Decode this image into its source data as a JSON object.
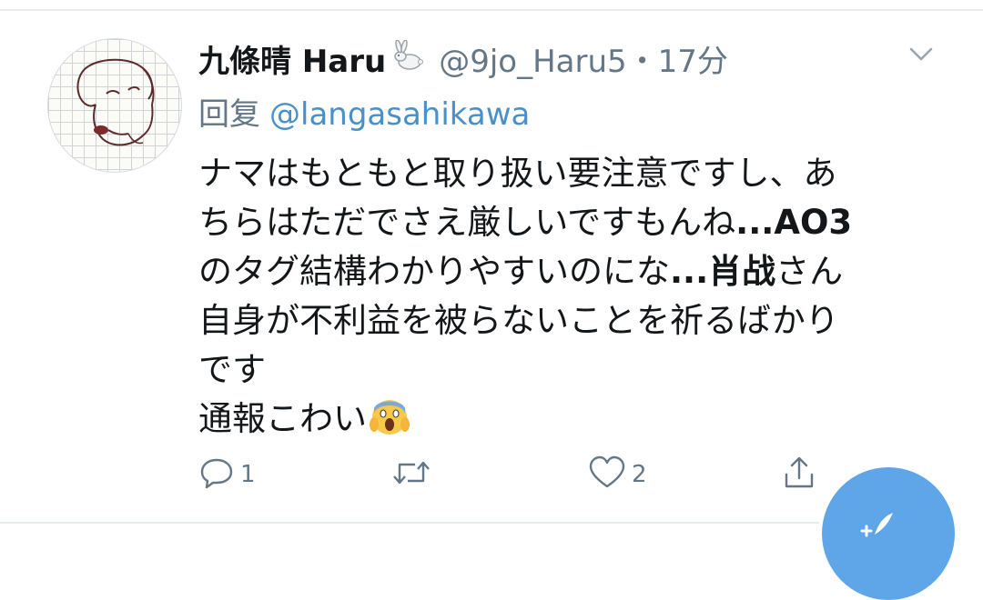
{
  "tweet": {
    "author": {
      "display_name": "九條晴 Haru",
      "name_emoji": "rabbit-emoji",
      "handle": "@9jo_Haru5",
      "separator": "・",
      "time": "17分",
      "avatar": "hand-drawn-dog-avatar"
    },
    "reply": {
      "prefix": "回复",
      "to_handle": "@langasahikawa"
    },
    "body": {
      "line1": "ナマはもともと取り扱い要注意ですし、あ",
      "line2_text": "ちらはただでさえ厳しいですもんね",
      "line2_bold": "...AO3",
      "line3_text": "のタグ結構わかりやすいのにな",
      "line3_bold": "...肖战",
      "line3_tail": "さん",
      "line4": "自身が不利益を被らないことを祈るばかり",
      "line5": "です",
      "line6": "通報こわい",
      "line6_emoji": "screaming-face-emoji"
    },
    "actions": {
      "reply_count": "1",
      "retweet_count": "",
      "like_count": "2",
      "share_count": ""
    },
    "menu_icon": "chevron-down-icon",
    "compose_icon": "compose-tweet-icon"
  },
  "colors": {
    "text": "#14171a",
    "secondary": "#657786",
    "link": "#4a90c8",
    "fab": "#5ea6e8"
  }
}
